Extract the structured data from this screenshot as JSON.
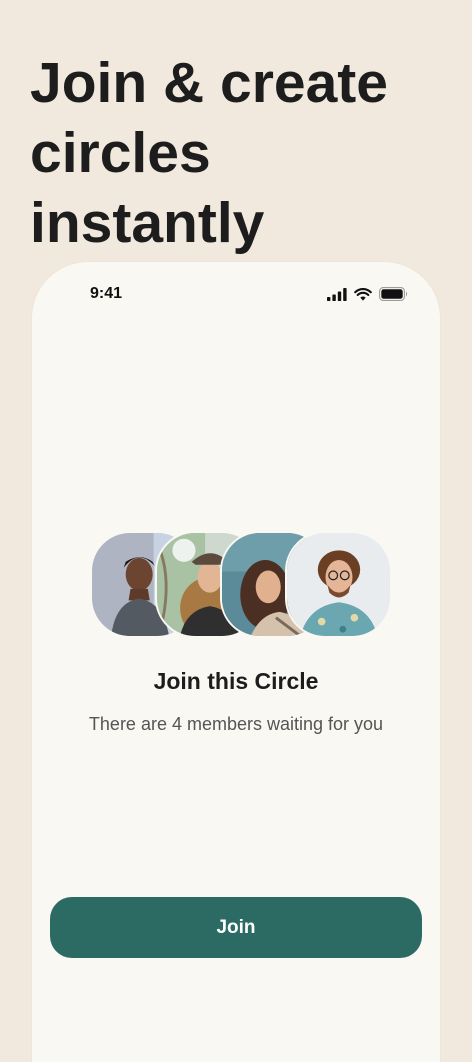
{
  "headline": {
    "line1": "Join & create",
    "line2": "circles instantly"
  },
  "status_bar": {
    "time": "9:41",
    "icons": [
      "cellular-signal-icon",
      "wifi-icon",
      "battery-icon"
    ]
  },
  "circle": {
    "members": [
      {
        "name": "member-1"
      },
      {
        "name": "member-2"
      },
      {
        "name": "member-3"
      },
      {
        "name": "member-4"
      }
    ],
    "title": "Join this Circle",
    "subtitle": "There are 4 members waiting for you"
  },
  "actions": {
    "join_label": "Join"
  },
  "colors": {
    "page_background": "#f1e9dd",
    "phone_background": "#faf8f3",
    "button": "#2b6b64",
    "text_primary": "#1d1d1d"
  }
}
